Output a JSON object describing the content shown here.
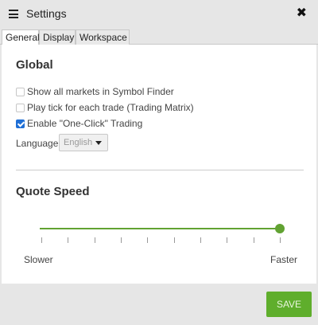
{
  "window": {
    "title": "Settings",
    "close_label": "✖"
  },
  "tabs": [
    {
      "label": "General",
      "active": true
    },
    {
      "label": "Display",
      "active": false
    },
    {
      "label": "Workspace",
      "active": false
    }
  ],
  "global": {
    "title": "Global",
    "options": [
      {
        "label": "Show all markets in Symbol Finder",
        "checked": false
      },
      {
        "label": "Play tick for each trade (Trading Matrix)",
        "checked": false
      },
      {
        "label": "Enable \"One-Click\" Trading",
        "checked": true
      }
    ],
    "language_label": "Language",
    "language_value": "English"
  },
  "quote_speed": {
    "title": "Quote Speed",
    "min_label": "Slower",
    "max_label": "Faster",
    "value_fraction": 1.0,
    "tick_count": 10
  },
  "footer": {
    "save_label": "SAVE"
  },
  "colors": {
    "accent": "#61a232",
    "checkbox_checked": "#1f6fd6"
  }
}
